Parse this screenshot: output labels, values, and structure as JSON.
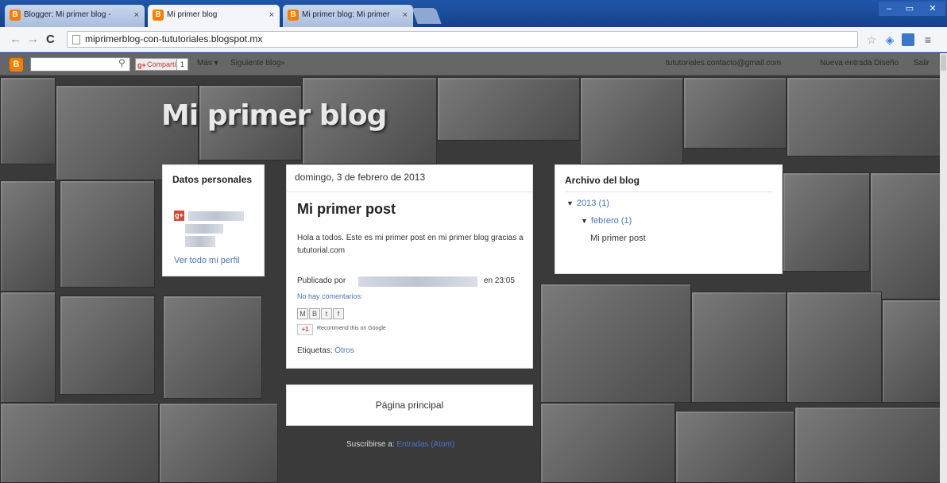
{
  "tabs": [
    {
      "label": "Blogger: Mi primer blog - ",
      "active": false
    },
    {
      "label": "Mi primer blog",
      "active": true
    },
    {
      "label": "Mi primer blog: Mi primer",
      "active": false
    }
  ],
  "toolbar": {
    "url": "miprimerblog-con-tututoriales.blogspot.mx"
  },
  "navbar": {
    "share_label": "Compartir",
    "share_count": "1",
    "more_label": "Más ▾",
    "next_blog_label": "Siguiente blog»",
    "email": "tututoriales.contacto@gmail.com",
    "new_post_label": "Nueva entrada",
    "design_label": "Diseño",
    "exit_label": "Salir"
  },
  "blog": {
    "title": "Mi primer blog"
  },
  "profile": {
    "heading": "Datos personales",
    "view_profile_link": "Ver todo mi perfil"
  },
  "post": {
    "date": "domingo, 3 de febrero de 2013",
    "title": "Mi primer post",
    "body": "Hola a todos. Este es mi primer post en mi primer blog gracias a tututorial.com",
    "published_by": "Publicado por",
    "published_time": "en 23:05",
    "comments_link": "No hay comentarios:",
    "share_icons": [
      "M",
      "B",
      "t",
      "f"
    ],
    "gplus_label": "+1",
    "gplus_text": "Recommend this on Google",
    "labels_heading": "Etiquetas:",
    "labels_value": "Otros"
  },
  "home_link": "Página principal",
  "subscribe": {
    "prefix": "Suscribirse a:",
    "link": "Entradas (Atom)"
  },
  "archive": {
    "heading": "Archivo del blog",
    "year": "2013 (1)",
    "month": "febrero (1)",
    "post": "Mi primer post"
  },
  "icons": {
    "blogger": "blogger-icon",
    "star": "star-icon",
    "extension": "extension-icon"
  }
}
